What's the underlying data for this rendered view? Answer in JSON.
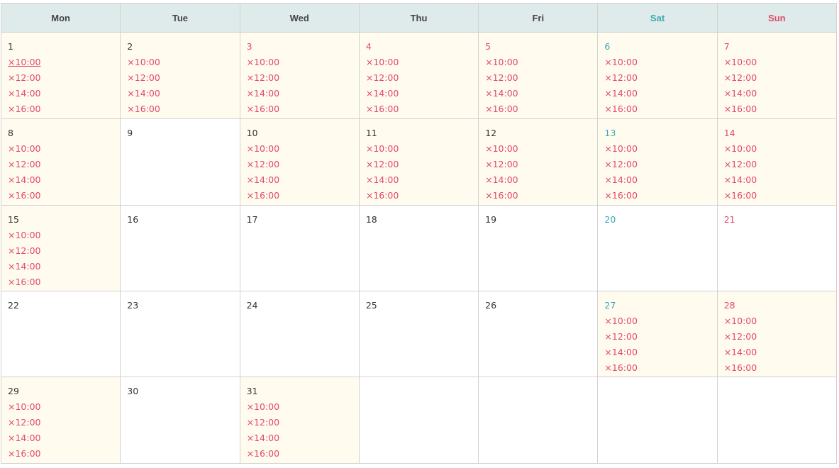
{
  "weekdays": [
    {
      "label": "Mon",
      "type": "weekday"
    },
    {
      "label": "Tue",
      "type": "weekday"
    },
    {
      "label": "Wed",
      "type": "weekday"
    },
    {
      "label": "Thu",
      "type": "weekday"
    },
    {
      "label": "Fri",
      "type": "weekday"
    },
    {
      "label": "Sat",
      "type": "sat"
    },
    {
      "label": "Sun",
      "type": "sun"
    }
  ],
  "colors": {
    "header_bg": "#dfeaea",
    "slot_cell_bg": "#fffbee",
    "unavailable_red": "#e2496b",
    "saturday_teal": "#3aa6b6",
    "text": "#333333",
    "border": "#d2d2d2"
  },
  "weeks": [
    [
      {
        "date": "1",
        "date_color": "default",
        "slots": [
          "×10:00",
          "×12:00",
          "×14:00",
          "×16:00"
        ],
        "first_slot_underlined": true
      },
      {
        "date": "2",
        "date_color": "default",
        "slots": [
          "×10:00",
          "×12:00",
          "×14:00",
          "×16:00"
        ]
      },
      {
        "date": "3",
        "date_color": "red",
        "slots": [
          "×10:00",
          "×12:00",
          "×14:00",
          "×16:00"
        ]
      },
      {
        "date": "4",
        "date_color": "red",
        "slots": [
          "×10:00",
          "×12:00",
          "×14:00",
          "×16:00"
        ]
      },
      {
        "date": "5",
        "date_color": "red",
        "slots": [
          "×10:00",
          "×12:00",
          "×14:00",
          "×16:00"
        ]
      },
      {
        "date": "6",
        "date_color": "teal",
        "slots": [
          "×10:00",
          "×12:00",
          "×14:00",
          "×16:00"
        ]
      },
      {
        "date": "7",
        "date_color": "red",
        "slots": [
          "×10:00",
          "×12:00",
          "×14:00",
          "×16:00"
        ]
      }
    ],
    [
      {
        "date": "8",
        "date_color": "default",
        "slots": [
          "×10:00",
          "×12:00",
          "×14:00",
          "×16:00"
        ]
      },
      {
        "date": "9",
        "date_color": "default",
        "slots": []
      },
      {
        "date": "10",
        "date_color": "default",
        "slots": [
          "×10:00",
          "×12:00",
          "×14:00",
          "×16:00"
        ]
      },
      {
        "date": "11",
        "date_color": "default",
        "slots": [
          "×10:00",
          "×12:00",
          "×14:00",
          "×16:00"
        ]
      },
      {
        "date": "12",
        "date_color": "default",
        "slots": [
          "×10:00",
          "×12:00",
          "×14:00",
          "×16:00"
        ]
      },
      {
        "date": "13",
        "date_color": "teal",
        "slots": [
          "×10:00",
          "×12:00",
          "×14:00",
          "×16:00"
        ]
      },
      {
        "date": "14",
        "date_color": "red",
        "slots": [
          "×10:00",
          "×12:00",
          "×14:00",
          "×16:00"
        ]
      }
    ],
    [
      {
        "date": "15",
        "date_color": "default",
        "slots": [
          "×10:00",
          "×12:00",
          "×14:00",
          "×16:00"
        ]
      },
      {
        "date": "16",
        "date_color": "default",
        "slots": []
      },
      {
        "date": "17",
        "date_color": "default",
        "slots": []
      },
      {
        "date": "18",
        "date_color": "default",
        "slots": []
      },
      {
        "date": "19",
        "date_color": "default",
        "slots": []
      },
      {
        "date": "20",
        "date_color": "teal",
        "slots": []
      },
      {
        "date": "21",
        "date_color": "red",
        "slots": []
      }
    ],
    [
      {
        "date": "22",
        "date_color": "default",
        "slots": []
      },
      {
        "date": "23",
        "date_color": "default",
        "slots": []
      },
      {
        "date": "24",
        "date_color": "default",
        "slots": []
      },
      {
        "date": "25",
        "date_color": "default",
        "slots": []
      },
      {
        "date": "26",
        "date_color": "default",
        "slots": []
      },
      {
        "date": "27",
        "date_color": "teal",
        "slots": [
          "×10:00",
          "×12:00",
          "×14:00",
          "×16:00"
        ]
      },
      {
        "date": "28",
        "date_color": "red",
        "slots": [
          "×10:00",
          "×12:00",
          "×14:00",
          "×16:00"
        ]
      }
    ],
    [
      {
        "date": "29",
        "date_color": "default",
        "slots": [
          "×10:00",
          "×12:00",
          "×14:00",
          "×16:00"
        ]
      },
      {
        "date": "30",
        "date_color": "default",
        "slots": []
      },
      {
        "date": "31",
        "date_color": "default",
        "slots": [
          "×10:00",
          "×12:00",
          "×14:00",
          "×16:00"
        ]
      },
      {
        "date": "",
        "date_color": "default",
        "slots": [],
        "empty": true
      },
      {
        "date": "",
        "date_color": "default",
        "slots": [],
        "empty": true
      },
      {
        "date": "",
        "date_color": "default",
        "slots": [],
        "empty": true
      },
      {
        "date": "",
        "date_color": "default",
        "slots": [],
        "empty": true
      }
    ]
  ]
}
